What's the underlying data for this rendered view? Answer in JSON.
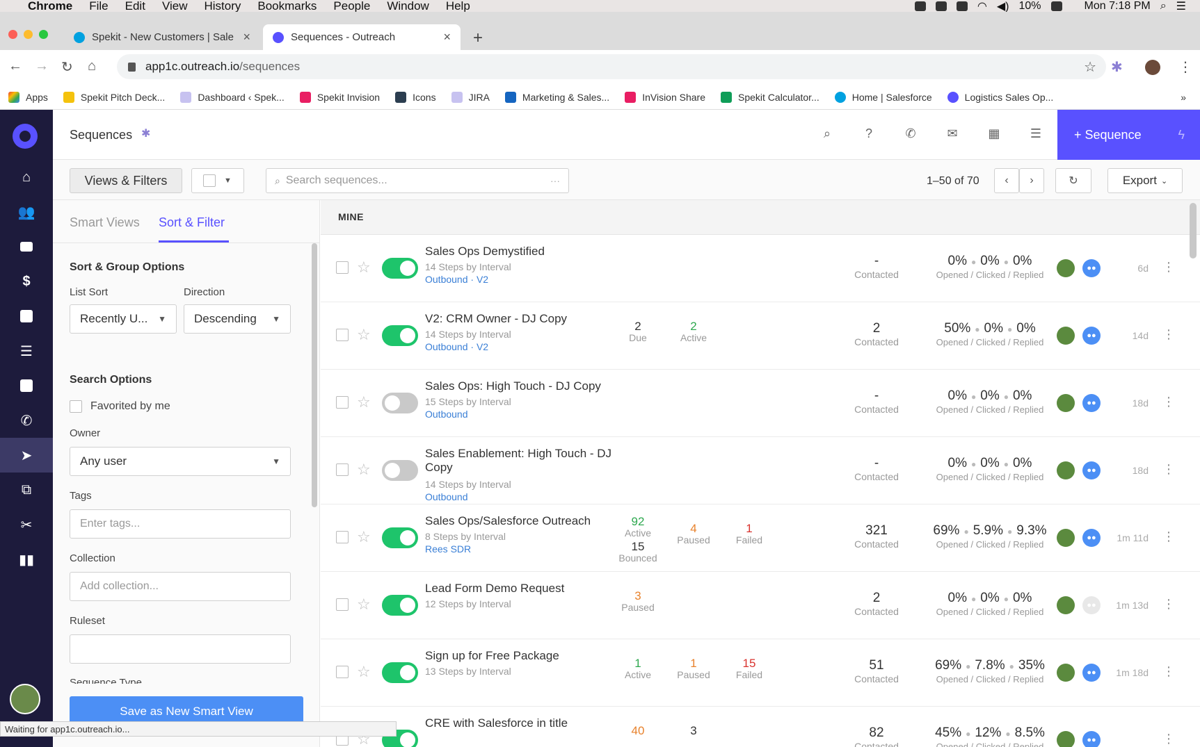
{
  "macos": {
    "menu": [
      "Chrome",
      "File",
      "Edit",
      "View",
      "History",
      "Bookmarks",
      "People",
      "Window",
      "Help"
    ],
    "battery": "10%",
    "clock": "Mon 7:18 PM"
  },
  "browser": {
    "tabs": [
      {
        "title": "Spekit - New Customers | Sale",
        "active": false
      },
      {
        "title": "Sequences - Outreach",
        "active": true
      }
    ],
    "url_host": "app1c.outreach.io",
    "url_path": "/sequences",
    "bookmarks": [
      "Apps",
      "Spekit Pitch Deck...",
      "Dashboard ‹ Spek...",
      "Spekit Invision",
      "Icons",
      "JIRA",
      "Marketing & Sales...",
      "InVision Share",
      "Spekit Calculator...",
      "Home | Salesforce",
      "Logistics Sales Op..."
    ],
    "bookmarks_overflow": "»",
    "status_text": "Waiting for app1c.outreach.io..."
  },
  "app": {
    "page_title": "Sequences",
    "new_sequence_label": "+ Sequence",
    "accent": "#5951ff",
    "nav_icons": [
      "home-icon",
      "people-icon",
      "briefcase-icon",
      "dollar-icon",
      "calendar-icon",
      "tasks-icon",
      "inbox-icon",
      "phone-icon",
      "send-icon",
      "copy-icon",
      "scissors-icon",
      "chart-icon"
    ]
  },
  "toolbar": {
    "views_filters_label": "Views & Filters",
    "search_placeholder": "Search sequences...",
    "search_more": "···",
    "pagination": "1–50 of 70",
    "export_label": "Export"
  },
  "panel": {
    "tabs": [
      "Smart Views",
      "Sort & Filter"
    ],
    "sort_group_title": "Sort & Group Options",
    "list_sort_label": "List Sort",
    "list_sort_value": "Recently U...",
    "direction_label": "Direction",
    "direction_value": "Descending",
    "search_options_title": "Search Options",
    "favorited_label": "Favorited by me",
    "owner_label": "Owner",
    "owner_value": "Any user",
    "tags_label": "Tags",
    "tags_placeholder": "Enter tags...",
    "collection_label": "Collection",
    "collection_placeholder": "Add collection...",
    "ruleset_label": "Ruleset",
    "ruleset_value": "",
    "sequence_type_label": "Sequence Type",
    "save_button": "Save as New Smart View"
  },
  "list": {
    "group_header": "MINE",
    "rate_labels": "Opened / Clicked / Replied",
    "contacted_label": "Contacted",
    "rows": [
      {
        "name": "Sales Ops Demystified",
        "steps": "14 Steps by Interval",
        "tags": "Outbound · V2",
        "enabled": true,
        "stats": [],
        "contacted": "-",
        "opened": "0%",
        "clicked": "0%",
        "replied": "0%",
        "age": "6d",
        "group_faded": false
      },
      {
        "name": "V2: CRM Owner - DJ Copy",
        "steps": "14 Steps by Interval",
        "tags": "Outbound · V2",
        "enabled": true,
        "stats": [
          {
            "n": "2",
            "l": "Due",
            "c": ""
          },
          {
            "n": "2",
            "l": "Active",
            "c": "green"
          }
        ],
        "contacted": "2",
        "opened": "50%",
        "clicked": "0%",
        "replied": "0%",
        "age": "14d",
        "group_faded": false
      },
      {
        "name": "Sales Ops: High Touch - DJ Copy",
        "steps": "15 Steps by Interval",
        "tags": "Outbound",
        "enabled": false,
        "stats": [],
        "contacted": "-",
        "opened": "0%",
        "clicked": "0%",
        "replied": "0%",
        "age": "18d",
        "group_faded": false
      },
      {
        "name": "Sales Enablement: High Touch - DJ Copy",
        "steps": "14 Steps by Interval",
        "tags": "Outbound",
        "enabled": false,
        "stats": [],
        "contacted": "-",
        "opened": "0%",
        "clicked": "0%",
        "replied": "0%",
        "age": "18d",
        "group_faded": false
      },
      {
        "name": "Sales Ops/Salesforce Outreach",
        "steps": "8 Steps by Interval",
        "tags": "Rees SDR",
        "enabled": true,
        "stats": [
          {
            "n": "92",
            "l": "Active",
            "c": "green"
          },
          {
            "n": "4",
            "l": "Paused",
            "c": "orange"
          },
          {
            "n": "1",
            "l": "Failed",
            "c": "red"
          },
          {
            "n": "15",
            "l": "Bounced",
            "c": ""
          }
        ],
        "contacted": "321",
        "opened": "69%",
        "clicked": "5.9%",
        "replied": "9.3%",
        "age": "1m 11d",
        "group_faded": false
      },
      {
        "name": "Lead Form Demo Request",
        "steps": "12 Steps by Interval",
        "tags": "",
        "enabled": true,
        "stats": [
          {
            "n": "3",
            "l": "Paused",
            "c": "orange"
          }
        ],
        "contacted": "2",
        "opened": "0%",
        "clicked": "0%",
        "replied": "0%",
        "age": "1m 13d",
        "group_faded": true
      },
      {
        "name": "Sign up for Free Package",
        "steps": "13 Steps by Interval",
        "tags": "",
        "enabled": true,
        "stats": [
          {
            "n": "1",
            "l": "Active",
            "c": "green"
          },
          {
            "n": "1",
            "l": "Paused",
            "c": "orange"
          },
          {
            "n": "15",
            "l": "Failed",
            "c": "red"
          }
        ],
        "contacted": "51",
        "opened": "69%",
        "clicked": "7.8%",
        "replied": "35%",
        "age": "1m 18d",
        "group_faded": false
      },
      {
        "name": "CRE with Salesforce in title",
        "steps": "",
        "tags": "",
        "enabled": true,
        "stats": [
          {
            "n": "40",
            "l": "",
            "c": "orange"
          },
          {
            "n": "3",
            "l": "",
            "c": ""
          }
        ],
        "contacted": "82",
        "opened": "45%",
        "clicked": "12%",
        "replied": "8.5%",
        "age": "",
        "group_faded": false
      }
    ]
  }
}
